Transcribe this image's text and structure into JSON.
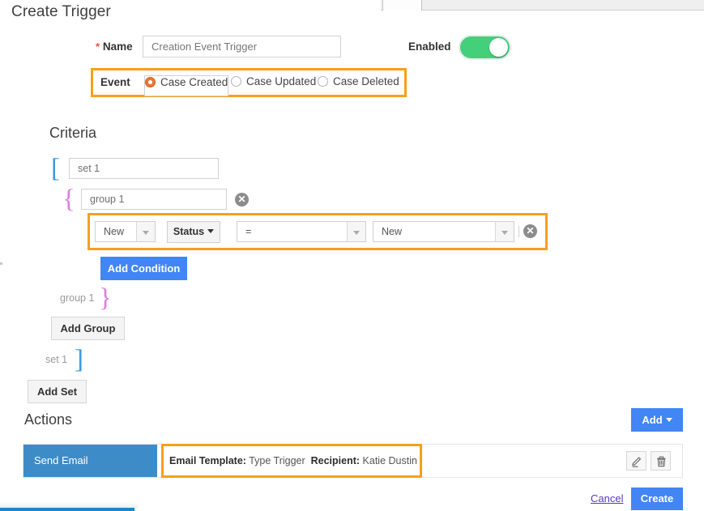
{
  "page_title": "Create Trigger",
  "form": {
    "name_label": "Name",
    "name_required_mark": "*",
    "name_value": "Creation Event Trigger",
    "name_placeholder": "Creation Event Trigger",
    "enabled_label": "Enabled",
    "enabled_state": "on",
    "event_label": "Event",
    "event_options": [
      {
        "label": "Case Created",
        "selected": true
      },
      {
        "label": "Case Updated",
        "selected": false
      },
      {
        "label": "Case Deleted",
        "selected": false
      }
    ]
  },
  "criteria": {
    "heading": "Criteria",
    "set_name": "set 1",
    "set_name_placeholder": "set 1",
    "group_name": "group 1",
    "group_name_placeholder": "group 1",
    "group_close_tag": "group 1",
    "set_close_tag": "set 1",
    "open_set_bracket": "[",
    "close_set_bracket": "]",
    "open_group_brace": "{",
    "close_group_brace": "}",
    "condition": {
      "field_value": "New",
      "object_button": "Status",
      "operator_value": "=",
      "compare_value": "New",
      "remove_label": "✕"
    },
    "group_remove_label": "✕",
    "add_condition_label": "Add Condition",
    "add_group_label": "Add Group",
    "add_set_label": "Add Set"
  },
  "actions": {
    "heading": "Actions",
    "add_button_label": "Add",
    "rows": [
      {
        "type": "Send Email",
        "detail_label_1": "Email Template:",
        "detail_value_1": "Type Trigger",
        "detail_label_2": "Recipient:",
        "detail_value_2": "Katie Dustin"
      }
    ]
  },
  "footer": {
    "cancel_label": "Cancel",
    "create_label": "Create"
  },
  "colors": {
    "highlight": "#f5a01a",
    "primary_blue": "#4285f4",
    "action_blue": "#3e8cc7",
    "toggle_green": "#44d07b",
    "radio_orange": "#e7773a",
    "set_bracket": "#3b9ae1",
    "group_brace": "#dc7fdc",
    "bottom_bar": "#1f86c8"
  }
}
